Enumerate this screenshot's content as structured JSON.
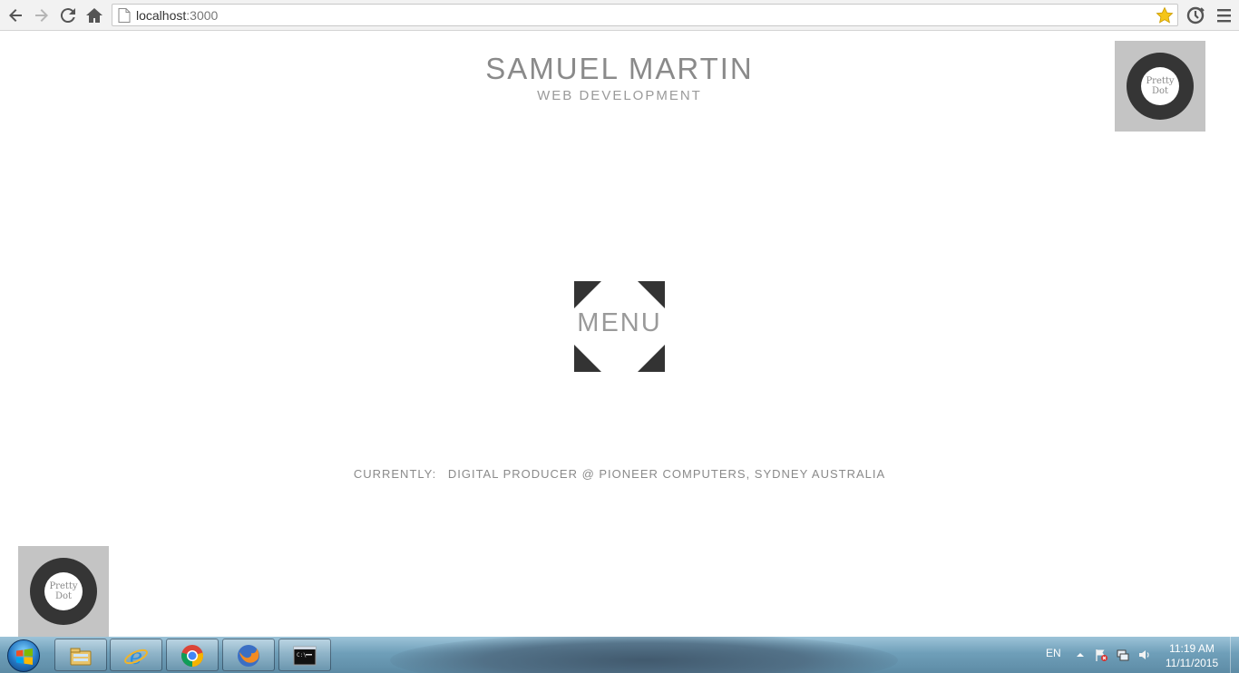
{
  "browser": {
    "url_host": "localhost",
    "url_port": ":3000",
    "icons": {
      "back": "back-arrow-icon",
      "forward": "forward-arrow-icon",
      "reload": "reload-icon",
      "home": "home-icon",
      "bookmark": "star-icon",
      "extension": "extension-icon",
      "menu": "hamburger-menu-icon"
    },
    "colors": {
      "star": "#f5c518"
    }
  },
  "header": {
    "title": "SAMUEL MARTIN",
    "subtitle": "WEB DEVELOPMENT"
  },
  "badges": {
    "top_right_text": "Pretty\nDot",
    "bottom_left_text": "Pretty\nDot"
  },
  "menu": {
    "label": "MENU"
  },
  "currently": {
    "label": "CURRENTLY:",
    "text": "DIGITAL PRODUCER @ PIONEER COMPUTERS, SYDNEY AUSTRALIA"
  },
  "taskbar": {
    "pinned": [
      "windows-explorer-icon",
      "internet-explorer-icon",
      "chrome-icon",
      "firefox-icon",
      "command-prompt-icon"
    ],
    "language": "EN",
    "time": "11:19 AM",
    "date": "11/11/2015"
  }
}
